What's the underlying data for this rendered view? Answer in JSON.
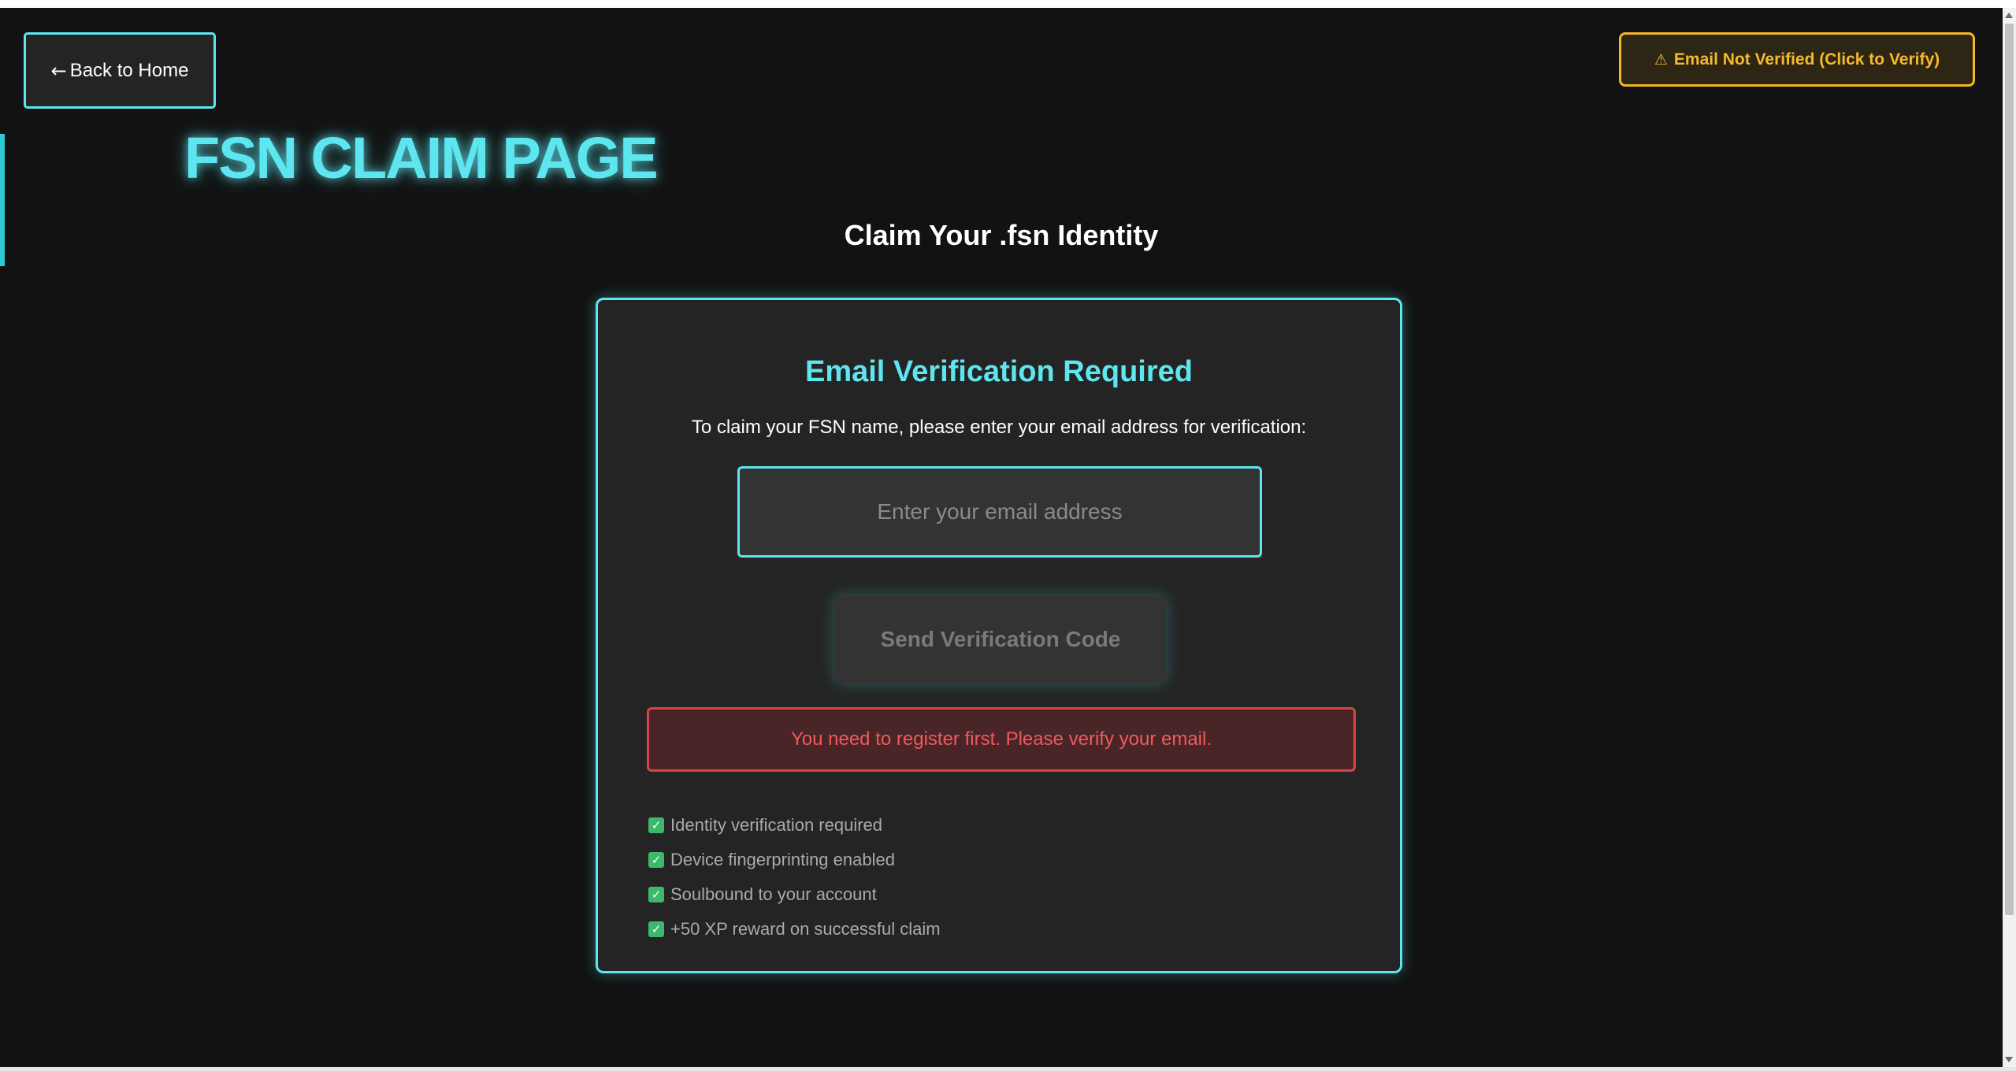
{
  "nav": {
    "back_arrow": "←",
    "back_label": "Back to Home"
  },
  "status": {
    "warning_glyph": "⚠",
    "email_status_label": "Email Not Verified (Click to Verify)"
  },
  "header": {
    "title": "FSN CLAIM PAGE",
    "subtitle": "Claim Your .fsn Identity"
  },
  "card": {
    "heading": "Email Verification Required",
    "instructions": "To claim your FSN name, please enter your email address for verification:",
    "email_value": "",
    "email_placeholder": "Enter your email address",
    "send_button_label": "Send Verification Code",
    "error_message": "You need to register first. Please verify your email.",
    "features": [
      {
        "icon": "check-icon",
        "glyph": "✓",
        "label": "Identity verification required"
      },
      {
        "icon": "check-icon",
        "glyph": "✓",
        "label": "Device fingerprinting enabled"
      },
      {
        "icon": "check-icon",
        "glyph": "✓",
        "label": "Soulbound to your account"
      },
      {
        "icon": "check-icon",
        "glyph": "✓",
        "label": "+50 XP reward on successful claim"
      }
    ]
  },
  "colors": {
    "background": "#121212",
    "accent_cyan": "#5ee6f0",
    "warning_amber": "#f6b92b",
    "error_red": "#f05a5a",
    "success_green": "#3cb96a",
    "card_background": "#242424"
  }
}
